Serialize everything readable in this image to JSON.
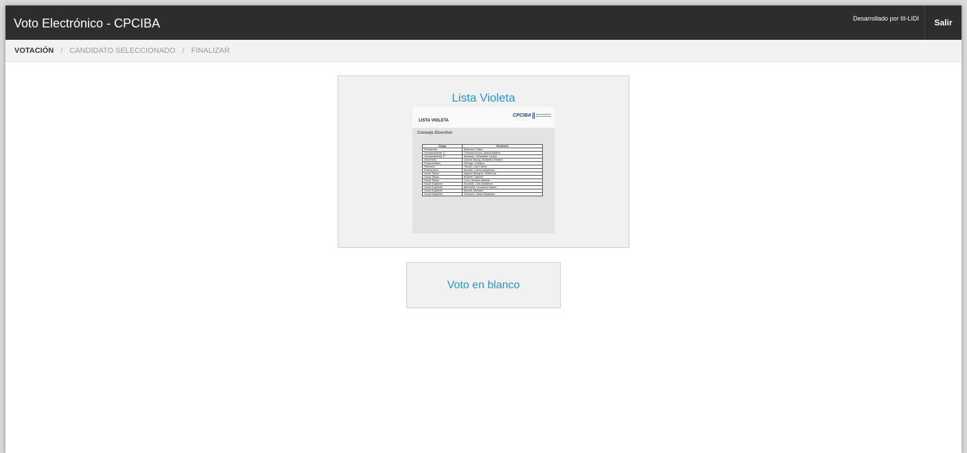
{
  "header": {
    "title": "Voto Electrónico - CPCIBA",
    "credit": "Desarrollado por III-LIDI",
    "logout_label": "Salir"
  },
  "breadcrumb": {
    "steps": [
      "VOTACIÓN",
      "CANDIDATO SELECCIONADO",
      "FINALIZAR"
    ],
    "separator": "/"
  },
  "list_card": {
    "title": "Lista Violeta",
    "ballot": {
      "list_name": "LISTA VIOLETA",
      "logo_text": "CPCIBA",
      "section": "Consejo Directivo",
      "columns": [
        "Cargo",
        "Nombres"
      ],
      "rows": [
        [
          "Presidente",
          "Barbosa, Pablo"
        ],
        [
          "Vicepresidente 1°",
          "Thomas Evans, María Martha"
        ],
        [
          "Vicepresidente 2°",
          "Martinez, Sebastián Carlos"
        ],
        [
          "Secretario",
          "Lavore Bourg, Alejandro Beatriz"
        ],
        [
          "Prosecretario",
          "Drengo, Gustavo"
        ],
        [
          "Tesorero",
          "Tiscoli, Luis Carlos"
        ],
        [
          "Protesorero",
          "Morbeli, Karina Alejandra"
        ],
        [
          "Vocal Titular",
          "Aguirre Bengoa, Guillermo"
        ],
        [
          "Vocal Titular",
          "Bonfoff, Gabriel"
        ],
        [
          "Vocal Titular",
          "Cruz, Andrea Mariela"
        ],
        [
          "Vocal Suplente",
          "Escobar, Luis Adalberto"
        ],
        [
          "Vocal Suplente",
          "Bertoletti, Leonardo Daniel"
        ],
        [
          "Vocal Suplente",
          "Morelli, Mariano"
        ],
        [
          "Vocal Suplente",
          "Yannone, Delia Alejandra"
        ]
      ]
    }
  },
  "blank_vote": {
    "label": "Voto en blanco"
  }
}
